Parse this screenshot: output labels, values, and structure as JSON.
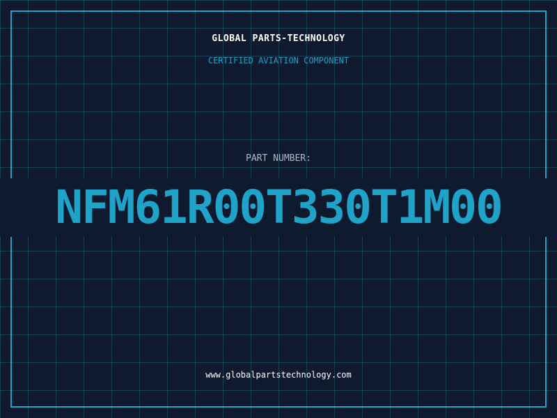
{
  "header": {
    "company": "GLOBAL PARTS-TECHNOLOGY",
    "subtitle": "CERTIFIED AVIATION COMPONENT"
  },
  "part": {
    "label": "PART NUMBER:",
    "number": "NFM61R00T330T1M00"
  },
  "footer": {
    "url": "www.globalpartstechnology.com"
  },
  "colors": {
    "background": "#0f1a2e",
    "accent": "#1fa3c8",
    "text": "#ffffff",
    "muted": "#b0b8c8"
  }
}
